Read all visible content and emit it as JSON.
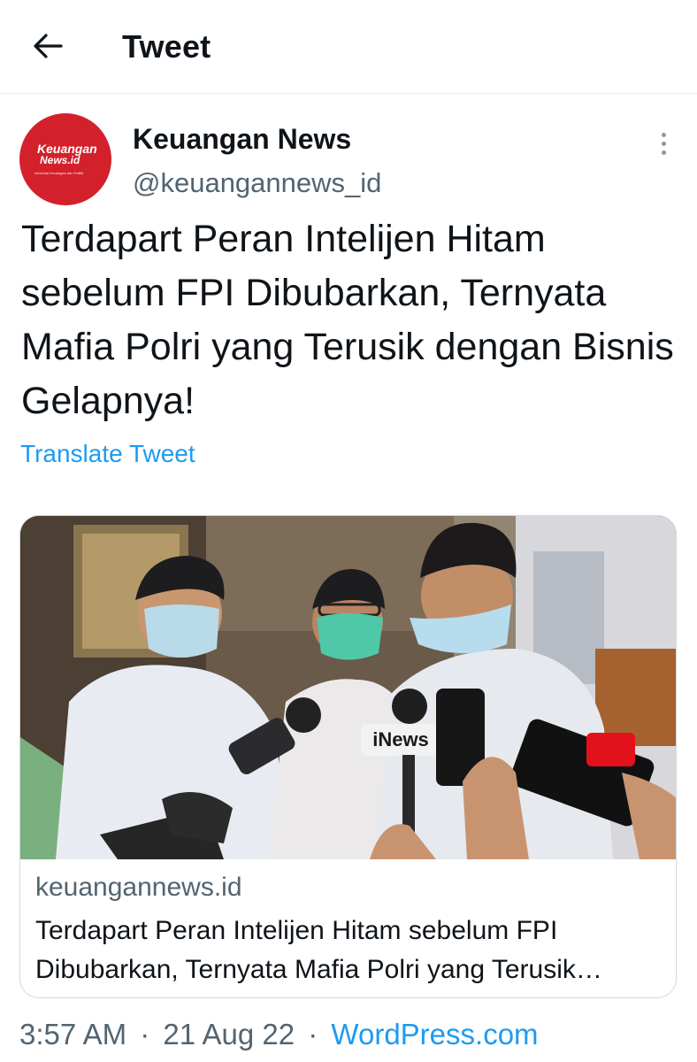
{
  "header": {
    "back_icon": "arrow-left-icon",
    "title": "Tweet"
  },
  "author": {
    "display_name": "Keuangan News",
    "handle": "@keuangannews_id",
    "avatar": {
      "logo_line1": "Keuangan",
      "logo_line2": "News.id",
      "tagline": "Informasi Keuangan dan Politik",
      "bg_color": "#d3212b"
    }
  },
  "more_icon": "more-vertical-icon",
  "tweet": {
    "text": "Terdapart Peran Intelijen Hitam sebelum FPI Dibubarkan, Ternyata Mafia Polri yang Terusik dengan Bisnis Gelapnya!",
    "translate_label": "Translate Tweet"
  },
  "link_card": {
    "image_description": "photo-of-men-in-face-masks-speaking-into-press-microphones",
    "mic_label": "iNews",
    "domain": "keuangannews.id",
    "title": "Terdapart Peran Intelijen Hitam sebelum FPI Dibubarkan, Ternyata Mafia Polri yang Terusik…"
  },
  "meta": {
    "time": "3:57 AM",
    "separator": "·",
    "date": "21 Aug 22",
    "source": "WordPress.com"
  },
  "colors": {
    "accent": "#1d9bf0",
    "text": "#0f1419",
    "secondary": "#536471",
    "border": "#cfd9de"
  }
}
